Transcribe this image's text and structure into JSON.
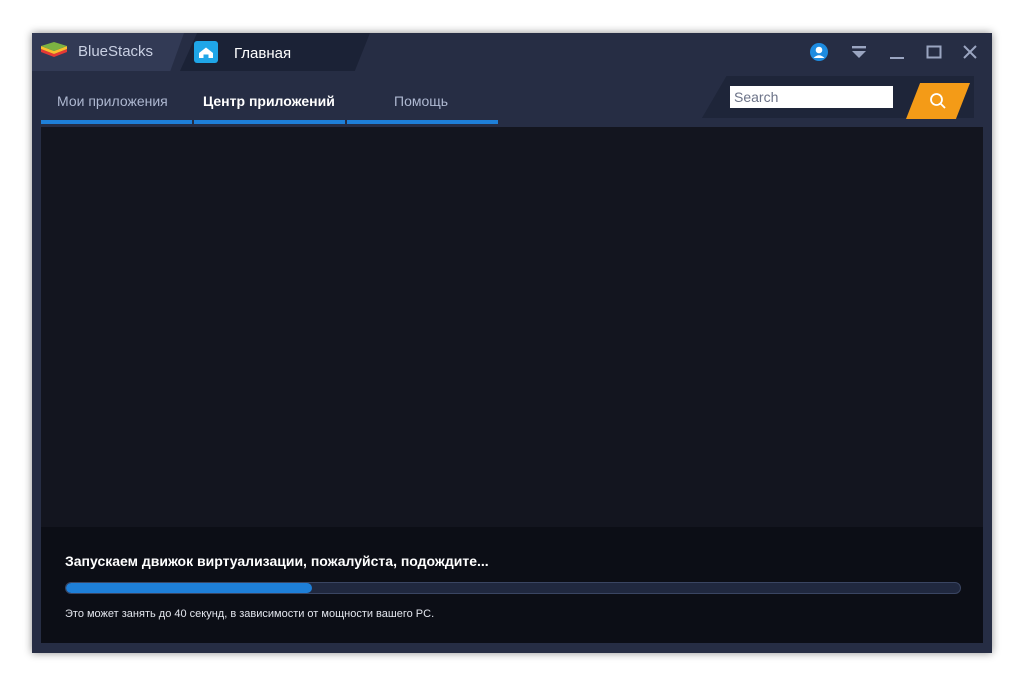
{
  "app": {
    "brand_name": "BlueStacks",
    "tab_title": "Главная"
  },
  "icons": {
    "brand": "bluestacks-logo-icon",
    "home": "home-icon",
    "user": "user-icon",
    "menu": "dropdown-menu-icon",
    "minimize": "minimize-icon",
    "maximize": "maximize-icon",
    "close": "close-icon",
    "search": "search-icon"
  },
  "nav": {
    "items": [
      {
        "label": "Мои приложения",
        "active": false
      },
      {
        "label": "Центр приложений",
        "active": true
      },
      {
        "label": "Помощь",
        "active": false
      }
    ]
  },
  "search": {
    "placeholder": "Search",
    "value": ""
  },
  "status": {
    "title": "Запускаем движок виртуализации, пожалуйста, подождите...",
    "progress": 0.275,
    "note": "Это может занять до 40 секунд, в зависимости от мощности вашего PC."
  },
  "colors": {
    "accent": "#1e7fd8",
    "search_button": "#f49b17",
    "window_bg": "#262d44",
    "content_bg": "#13151f"
  }
}
